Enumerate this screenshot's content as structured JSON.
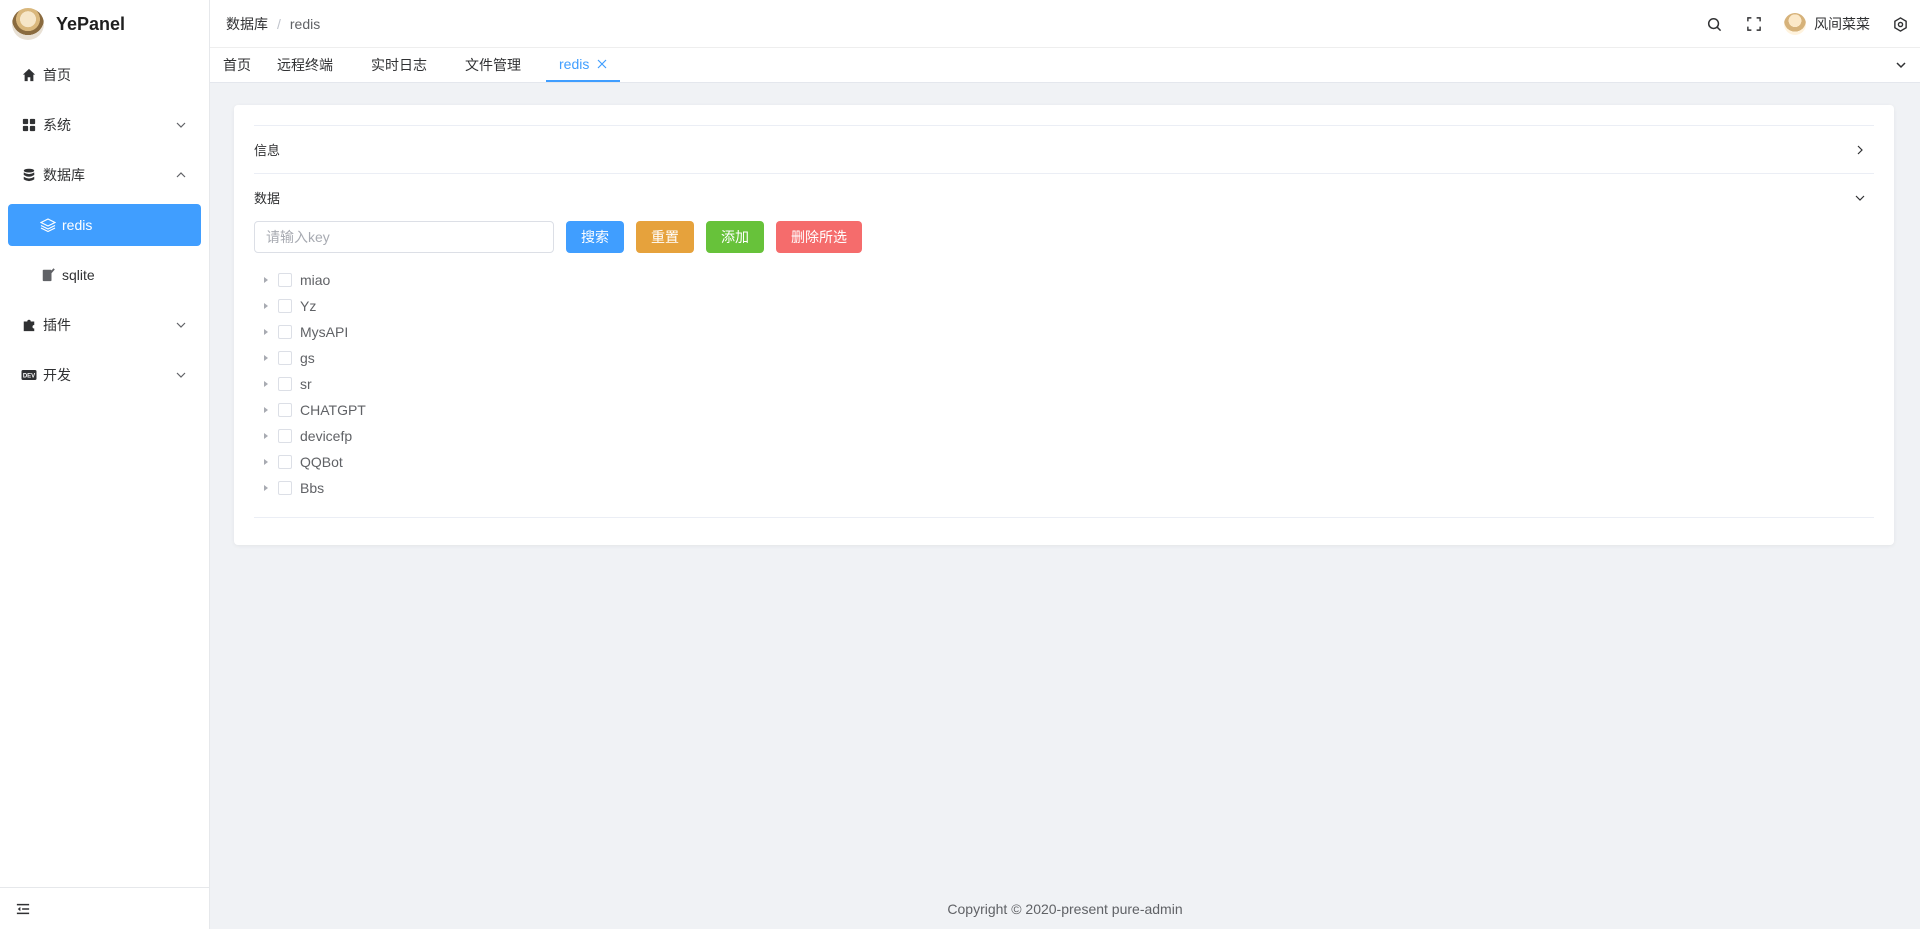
{
  "app": {
    "title": "YePanel"
  },
  "sidebar": {
    "items": [
      {
        "label": "首页",
        "icon": "home-icon"
      },
      {
        "label": "系统",
        "icon": "grid-icon"
      },
      {
        "label": "数据库",
        "icon": "database-icon",
        "children": [
          {
            "label": "redis",
            "icon": "layers-icon",
            "active": true
          },
          {
            "label": "sqlite",
            "icon": "feather-icon"
          }
        ]
      },
      {
        "label": "插件",
        "icon": "puzzle-icon"
      },
      {
        "label": "开发",
        "icon": "dev-icon"
      }
    ]
  },
  "header": {
    "breadcrumb": [
      "数据库",
      "redis"
    ],
    "user": "风间菜菜"
  },
  "tabs": [
    "首页",
    "远程终端",
    "实时日志",
    "文件管理",
    "redis"
  ],
  "panel": {
    "info_title": "信息",
    "data_title": "数据",
    "search_placeholder": "请输入key",
    "buttons": {
      "search": "搜索",
      "reset": "重置",
      "add": "添加",
      "delete": "删除所选"
    },
    "keys": [
      "miao",
      "Yz",
      "MysAPI",
      "gs",
      "sr",
      "CHATGPT",
      "devicefp",
      "QQBot",
      "Bbs"
    ]
  },
  "footer": {
    "copyright": "Copyright © 2020-present pure-admin"
  },
  "colors": {
    "accent": "#409eff",
    "warning": "#e6a23c",
    "success": "#67c23a",
    "danger": "#f56c6c"
  }
}
